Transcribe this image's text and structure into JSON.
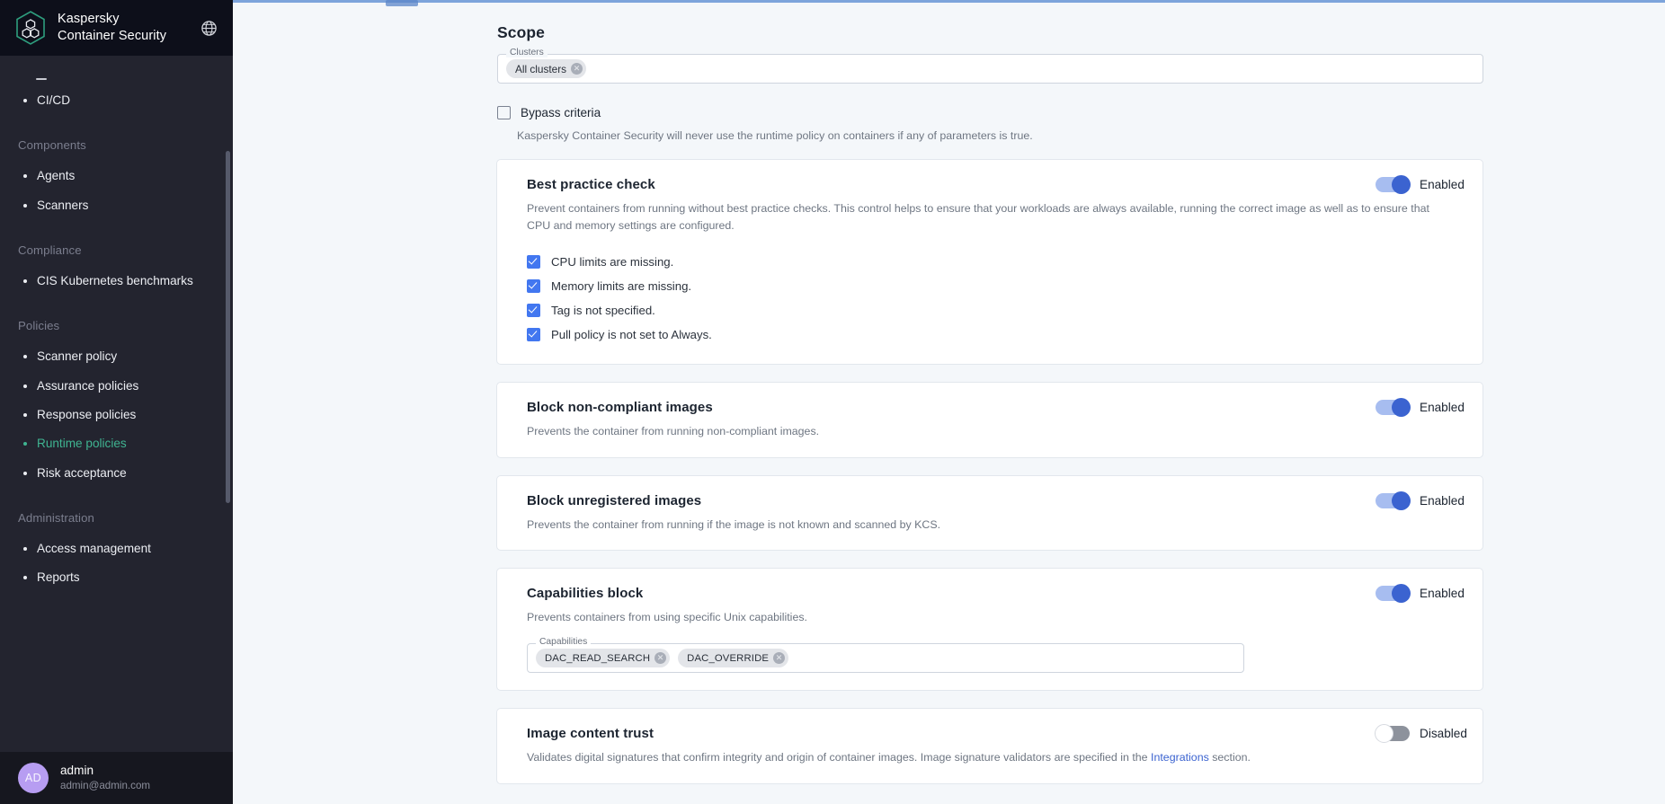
{
  "brand": {
    "line1": "Kaspersky",
    "line2": "Container Security",
    "logo_icon": "kaspersky-cube-hex-icon",
    "globe_icon": "globe-icon"
  },
  "sidebar": {
    "items": [
      {
        "type": "partial",
        "label": ""
      },
      {
        "type": "item",
        "label": "CI/CD",
        "active": false
      },
      {
        "type": "group",
        "label": "Components"
      },
      {
        "type": "item",
        "label": "Agents",
        "active": false
      },
      {
        "type": "item",
        "label": "Scanners",
        "active": false
      },
      {
        "type": "group",
        "label": "Compliance"
      },
      {
        "type": "item",
        "label": "CIS Kubernetes benchmarks",
        "active": false
      },
      {
        "type": "group",
        "label": "Policies"
      },
      {
        "type": "item",
        "label": "Scanner policy",
        "active": false
      },
      {
        "type": "item",
        "label": "Assurance policies",
        "active": false
      },
      {
        "type": "item",
        "label": "Response policies",
        "active": false
      },
      {
        "type": "item",
        "label": "Runtime policies",
        "active": true
      },
      {
        "type": "item",
        "label": "Risk acceptance",
        "active": false
      },
      {
        "type": "group",
        "label": "Administration"
      },
      {
        "type": "item",
        "label": "Access management",
        "active": false
      },
      {
        "type": "item",
        "label": "Reports",
        "active": false
      }
    ],
    "active_color": "#3fb491",
    "background": "#23242f",
    "user": {
      "initials": "AD",
      "name": "admin",
      "email": "admin@admin.com",
      "avatar_color": "#b79df2"
    }
  },
  "main": {
    "scope": {
      "title": "Scope",
      "clusters_legend": "Clusters",
      "clusters_chips": [
        "All clusters"
      ],
      "bypass_label": "Bypass criteria",
      "bypass_checked": false,
      "bypass_help": "Kaspersky Container Security will never use the runtime policy on containers if any of parameters is true."
    },
    "labels": {
      "enabled": "Enabled",
      "disabled": "Disabled"
    },
    "cards": [
      {
        "title": "Best practice check",
        "desc": "Prevent containers from running without best practice checks. This control helps to ensure that your workloads are always available, running the correct image as well as to ensure that CPU and memory settings are configured.",
        "toggle_on": true,
        "toggle_label": "Enabled",
        "checks": [
          {
            "label": "CPU limits are missing.",
            "checked": true
          },
          {
            "label": "Memory limits are missing.",
            "checked": true
          },
          {
            "label": "Tag is not specified.",
            "checked": true
          },
          {
            "label": "Pull policy is not set to Always.",
            "checked": true
          }
        ]
      },
      {
        "title": "Block non-compliant images",
        "desc": "Prevents the container from running non-compliant images.",
        "toggle_on": true,
        "toggle_label": "Enabled"
      },
      {
        "title": "Block unregistered images",
        "desc": "Prevents the container from running if the image is not known and scanned by KCS.",
        "toggle_on": true,
        "toggle_label": "Enabled"
      },
      {
        "title": "Capabilities block",
        "desc": "Prevents containers from using specific Unix capabilities.",
        "toggle_on": true,
        "toggle_label": "Enabled",
        "capabilities_legend": "Capabilities",
        "capabilities": [
          "DAC_READ_SEARCH",
          "DAC_OVERRIDE"
        ]
      },
      {
        "title": "Image content trust",
        "desc_before": "Validates digital signatures that confirm integrity and origin of container images. Image signature validators are specified in the ",
        "desc_link": "Integrations",
        "desc_after": " section.",
        "toggle_on": false,
        "toggle_label": "Disabled"
      }
    ]
  },
  "colors": {
    "accent_blue": "#3b63d0",
    "toggle_track_on": "#a7bdf0",
    "toggle_track_off": "#8d929c",
    "checkbox_blue": "#4277f0",
    "page_bg": "#f4f7fa"
  }
}
